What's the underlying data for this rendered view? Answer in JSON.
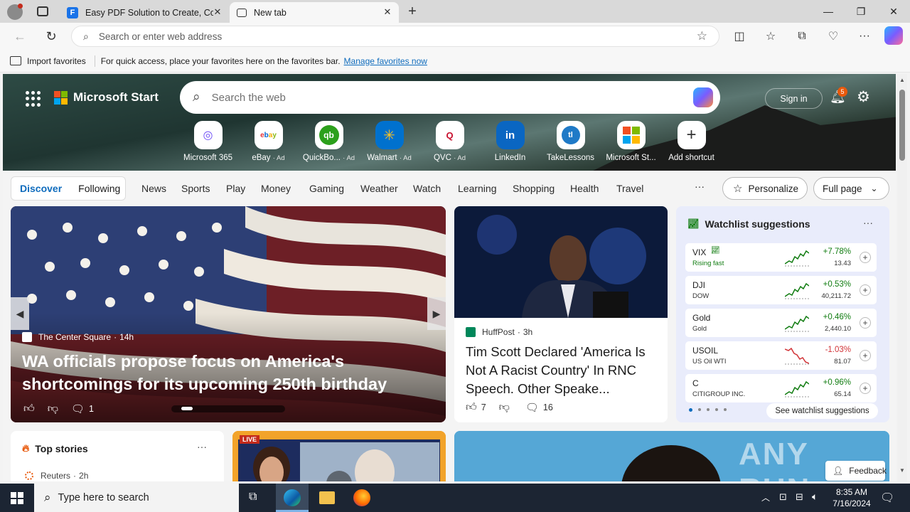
{
  "browser": {
    "tabs": [
      {
        "title": "Easy PDF Solution to Create, Con",
        "active": false
      },
      {
        "title": "New tab",
        "active": true
      }
    ],
    "address_placeholder": "Search or enter web address",
    "favorites_bar": {
      "import_label": "Import favorites",
      "hint_text": "For quick access, place your favorites here on the favorites bar.",
      "manage_link": "Manage favorites now"
    }
  },
  "ms_start": {
    "brand": "Microsoft Start",
    "search_placeholder": "Search the web",
    "sign_in": "Sign in",
    "notification_count": "5",
    "shortcuts": [
      {
        "label": "Microsoft 365",
        "ad": ""
      },
      {
        "label": "eBay",
        "ad": "· Ad"
      },
      {
        "label": "QuickBo...",
        "ad": "· Ad"
      },
      {
        "label": "Walmart",
        "ad": "· Ad"
      },
      {
        "label": "QVC",
        "ad": "· Ad"
      },
      {
        "label": "LinkedIn",
        "ad": ""
      },
      {
        "label": "TakeLessons",
        "ad": ""
      },
      {
        "label": "Microsoft St...",
        "ad": ""
      },
      {
        "label": "Add shortcut",
        "ad": ""
      }
    ],
    "nav": {
      "discover": "Discover",
      "following": "Following",
      "links": [
        "News",
        "Sports",
        "Play",
        "Money",
        "Gaming",
        "Weather",
        "Watch",
        "Learning",
        "Shopping",
        "Health",
        "Travel"
      ],
      "more": "···",
      "personalize": "Personalize",
      "full_page": "Full page"
    },
    "main_story": {
      "source": "The Center Square",
      "age": "14h",
      "headline": "WA officials propose focus on America's shortcomings for its upcoming 250th birthday",
      "comments": "1"
    },
    "second_story": {
      "source": "HuffPost",
      "age": "3h",
      "headline": "Tim Scott Declared 'America Is Not A Racist Country' In RNC Speech. Other Speake...",
      "likes": "7",
      "comments": "16"
    },
    "watchlist": {
      "title": "Watchlist suggestions",
      "see_more": "See watchlist suggestions",
      "stocks": [
        {
          "symbol": "VIX",
          "name": "Rising fast",
          "change": "+7.78%",
          "price": "13.43",
          "up": true,
          "trending": true
        },
        {
          "symbol": "DJI",
          "name": "DOW",
          "change": "+0.53%",
          "price": "40,211.72",
          "up": true,
          "trending": false
        },
        {
          "symbol": "Gold",
          "name": "Gold",
          "change": "+0.46%",
          "price": "2,440.10",
          "up": true,
          "trending": false
        },
        {
          "symbol": "USOIL",
          "name": "US Oil WTI",
          "change": "-1.03%",
          "price": "81.07",
          "up": false,
          "trending": false
        },
        {
          "symbol": "C",
          "name": "CITIGROUP INC.",
          "change": "+0.96%",
          "price": "65.14",
          "up": true,
          "trending": false
        }
      ]
    },
    "top_stories": {
      "title": "Top stories",
      "first_source": "Reuters",
      "first_age": "2h"
    },
    "live_badge": "LIVE",
    "feedback": "Feedback",
    "watermark": "ANY RUN"
  },
  "taskbar": {
    "search_placeholder": "Type here to search",
    "time": "8:35 AM",
    "date": "7/16/2024"
  },
  "colors": {
    "accent": "#0f6cbd",
    "up": "#107c10",
    "down": "#d13438",
    "taskbar": "#1c2533"
  }
}
